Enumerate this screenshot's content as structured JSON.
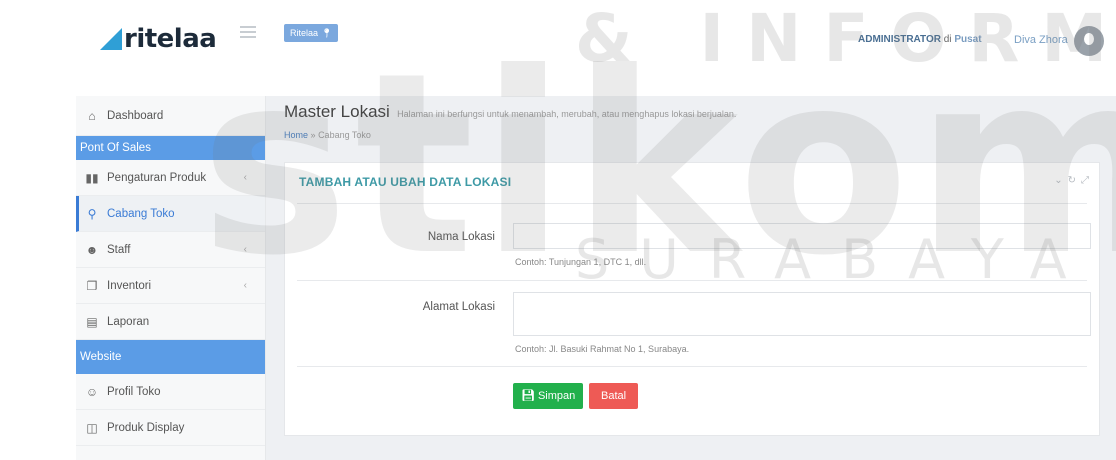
{
  "header": {
    "logo_text": "ritelaa",
    "store_button_label": "Ritelaa",
    "admin_role": "ADMINISTRATOR",
    "admin_at": "di",
    "admin_location": "Pusat",
    "user_name": "Diva Zhora"
  },
  "watermark": {
    "top_text": "& INFORMATIKA",
    "main_text": "stikom",
    "bottom_text": "SURABAYA"
  },
  "sidebar": {
    "dashboard": "Dashboard",
    "section_pos": "Pont Of Sales",
    "items_pos": [
      {
        "label": "Pengaturan Produk",
        "icon": "barcode-icon",
        "has_children": true
      },
      {
        "label": "Cabang Toko",
        "icon": "map-marker-icon",
        "active": true
      },
      {
        "label": "Staff",
        "icon": "users-icon",
        "has_children": true
      },
      {
        "label": "Inventori",
        "icon": "copy-icon",
        "has_children": true
      },
      {
        "label": "Laporan",
        "icon": "file-icon"
      }
    ],
    "section_web": "Website",
    "items_web": [
      {
        "label": "Profil Toko",
        "icon": "user-icon"
      },
      {
        "label": "Produk Display",
        "icon": "gift-icon"
      }
    ]
  },
  "page": {
    "title": "Master Lokasi",
    "subtitle": "Halaman ini berfungsi untuk menambah, merubah, atau menghapus lokasi berjualan.",
    "breadcrumb_home": "Home",
    "breadcrumb_sep": "»",
    "breadcrumb_current": "Cabang Toko"
  },
  "panel": {
    "title": "TAMBAH ATAU UBAH DATA LOKASI",
    "field_name_label": "Nama Lokasi",
    "field_name_value": "",
    "field_name_help": "Contoh: Tunjungan 1, DTC 1, dll.",
    "field_address_label": "Alamat Lokasi",
    "field_address_value": "",
    "field_address_help": "Contoh: Jl. Basuki Rahmat No 1, Surabaya.",
    "save_label": "Simpan",
    "cancel_label": "Batal"
  },
  "colors": {
    "accent": "#5b9ce6",
    "panel_title": "#3e9aa6",
    "save": "#22b04c",
    "cancel": "#ee5a55"
  }
}
